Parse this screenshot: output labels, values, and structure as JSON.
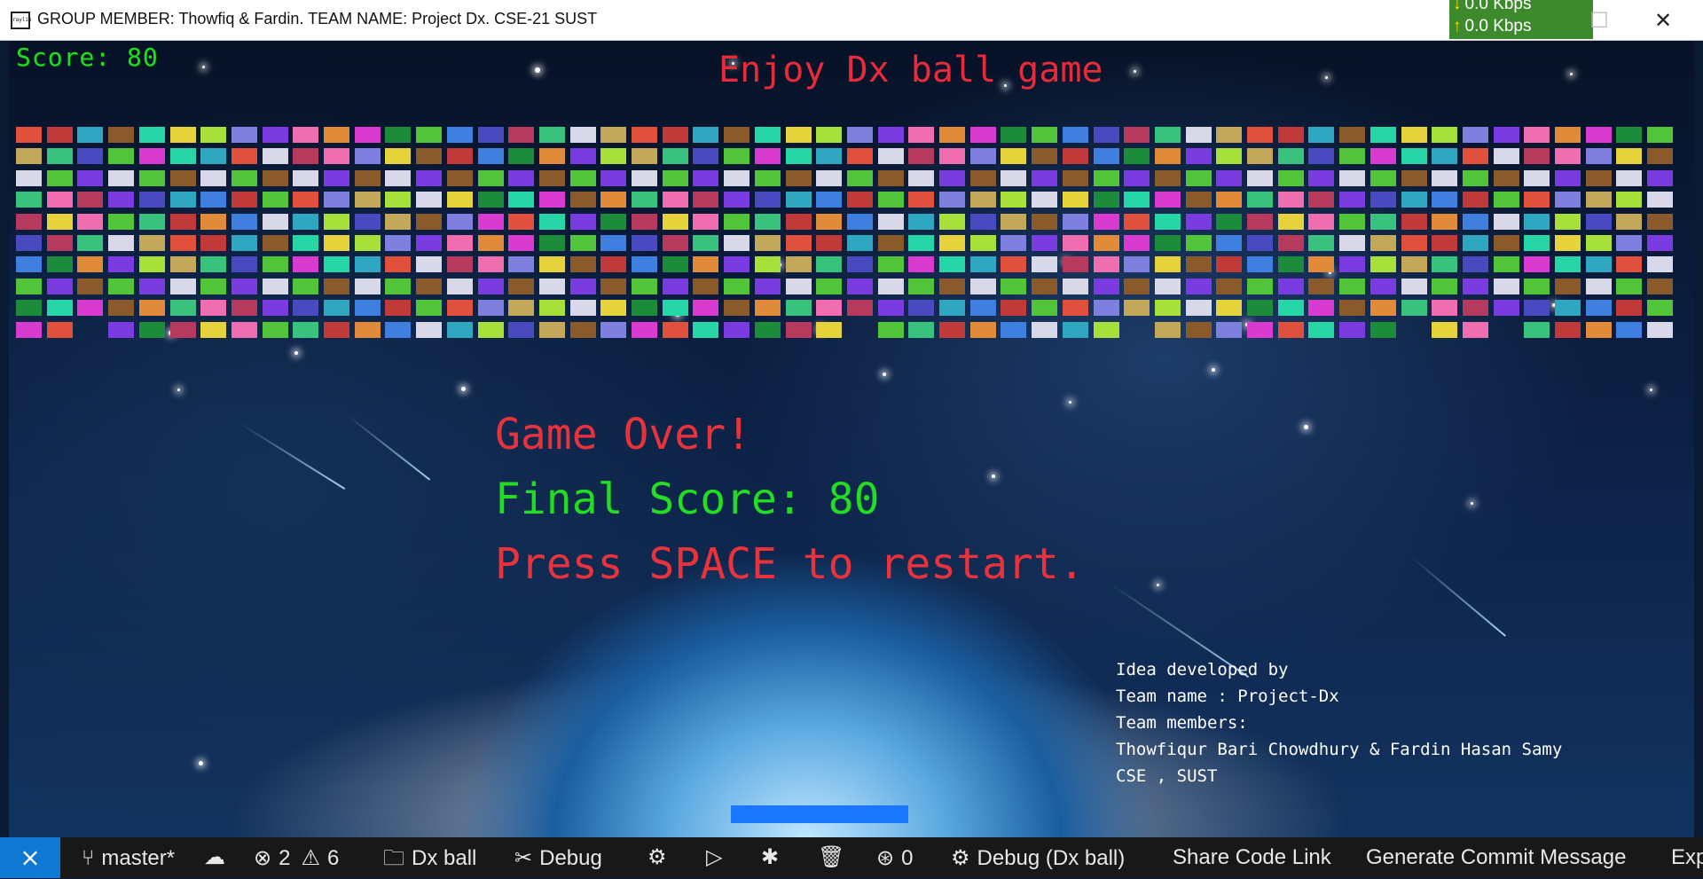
{
  "window": {
    "title": "GROUP MEMBER: Thowfiq & Fardin. TEAM NAME: Project Dx. CSE-21 SUST",
    "app_icon_label": "raylib"
  },
  "network_monitor": {
    "upload": "0.0 Kbps",
    "download": "0.0 Kbps"
  },
  "game": {
    "score_label": "Score: 80",
    "heading": "Enjoy Dx ball game",
    "game_over": "Game Over!",
    "final_score": "Final Score: 80",
    "restart_prompt": "Press SPACE to restart.",
    "credits": [
      "Idea developed by",
      "Team name : Project-Dx",
      "Team members:",
      "Thowfiqur Bari Chowdhury & Fardin Hasan Samy",
      "CSE , SUST"
    ],
    "colors": {
      "score": "#22dd22",
      "heading": "#e82b3a",
      "paddle": "#1b77ff"
    },
    "brick_rows": 10,
    "brick_cols": 54,
    "brick_palette": [
      "#e0503c",
      "#39c27e",
      "#3f7fe0",
      "#d93bd0",
      "#7a3ce0",
      "#e6d23a",
      "#2fa7c0",
      "#c4a85a",
      "#b53a5e",
      "#52c43a",
      "#e08a3a",
      "#7f7fe0",
      "#26d6a6",
      "#c03a3a",
      "#d8d8e8",
      "#4a4ac0",
      "#1d8c3a",
      "#f06db0",
      "#a8e03a",
      "#8a5a2a"
    ],
    "missing_bricks": [
      [
        9,
        2
      ],
      [
        9,
        27
      ],
      [
        9,
        36
      ],
      [
        9,
        45
      ],
      [
        9,
        48
      ]
    ]
  },
  "statusbar": {
    "branch": "master*",
    "errors": "2",
    "warnings": "6",
    "project": "Dx ball",
    "debug": "Debug",
    "ports": "0",
    "debug_target": "Debug (Dx ball)",
    "share": "Share Code Link",
    "commit": "Generate Commit Message",
    "extra": "Exp"
  }
}
